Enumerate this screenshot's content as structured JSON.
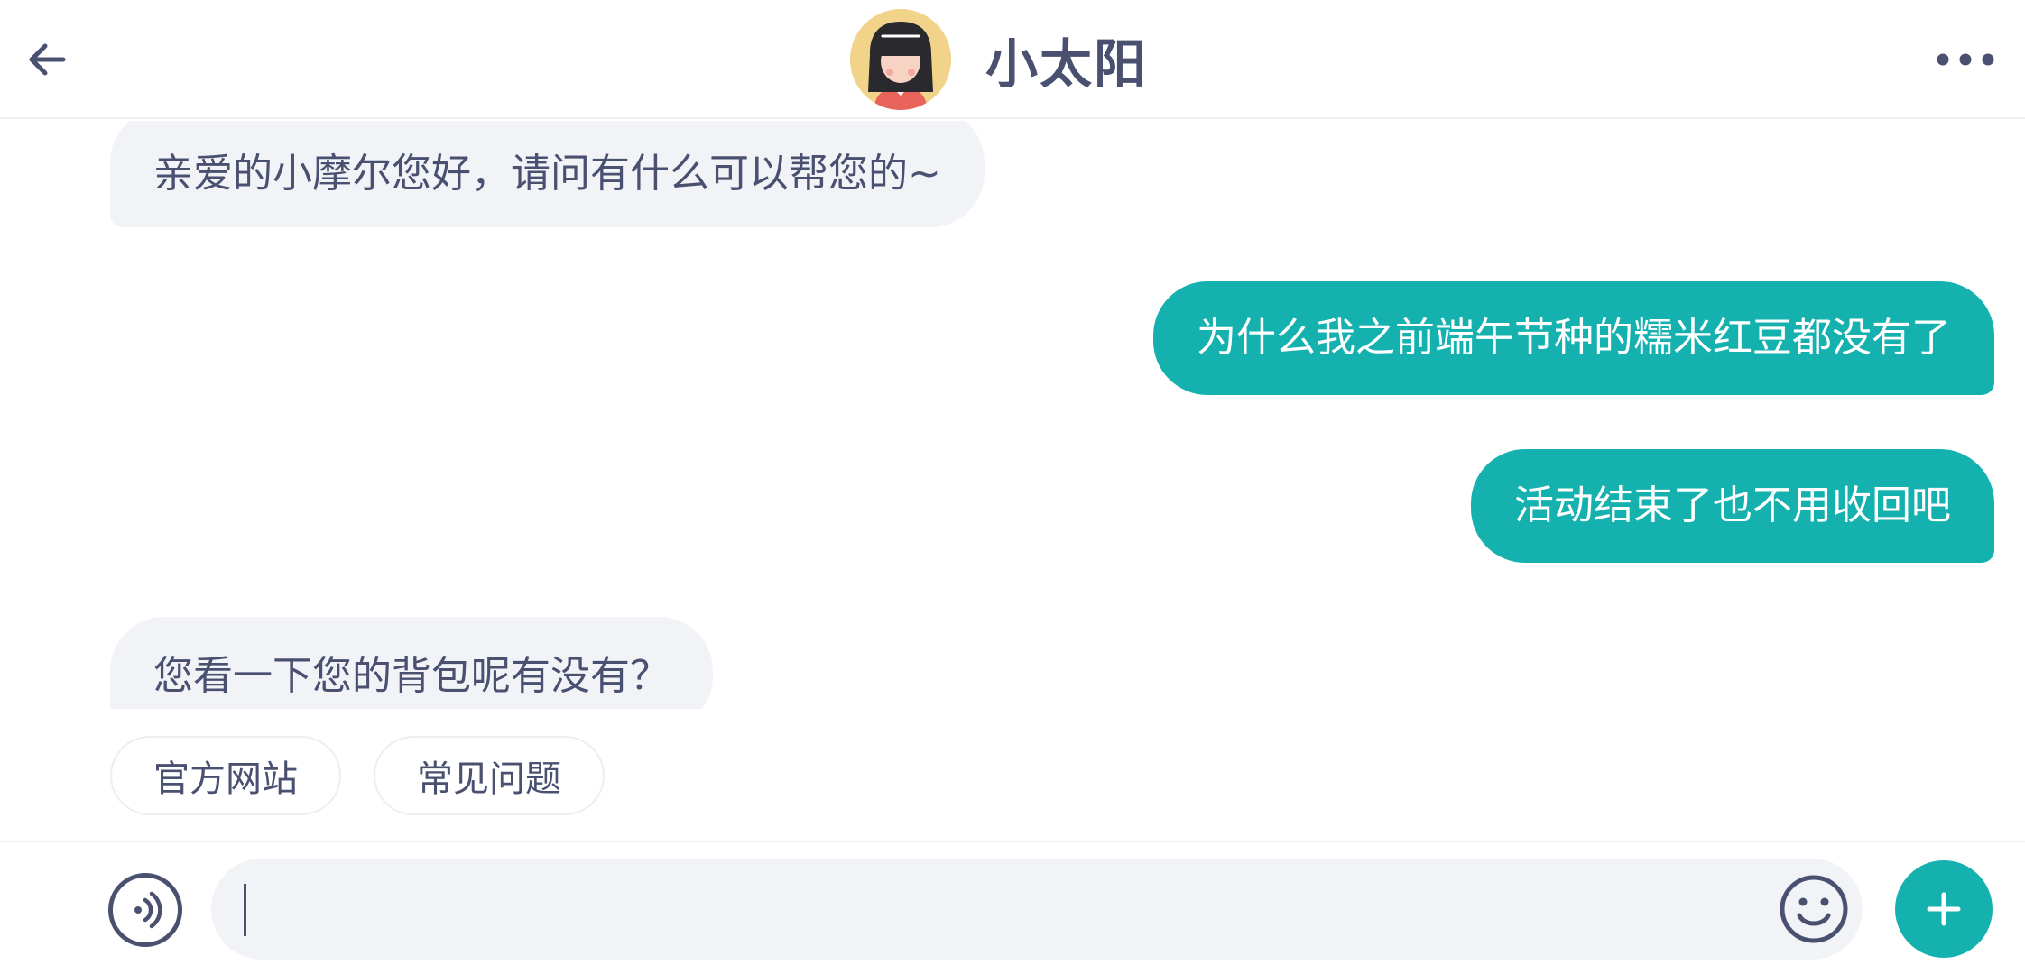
{
  "header": {
    "back_icon": "arrow-left-icon",
    "title": "小太阳",
    "more_icon": "more-horizontal-icon"
  },
  "messages": [
    {
      "side": "in",
      "text": "亲爱的小摩尔您好，请问有什么可以帮您的~"
    },
    {
      "side": "out",
      "text": "为什么我之前端午节种的糯米红豆都没有了"
    },
    {
      "side": "out",
      "text": "活动结束了也不用收回吧"
    },
    {
      "side": "in",
      "text": "您看一下您的背包呢有没有？"
    }
  ],
  "quick_replies": [
    {
      "label": "官方网站"
    },
    {
      "label": "常见问题"
    }
  ],
  "input": {
    "value": "",
    "placeholder": "",
    "voice_icon": "voice-icon",
    "emoji_icon": "emoji-smile-icon",
    "plus_icon": "plus-icon"
  },
  "colors": {
    "accent": "#14b1ae",
    "text": "#4a5070",
    "bubble_in": "#f1f3f7"
  }
}
